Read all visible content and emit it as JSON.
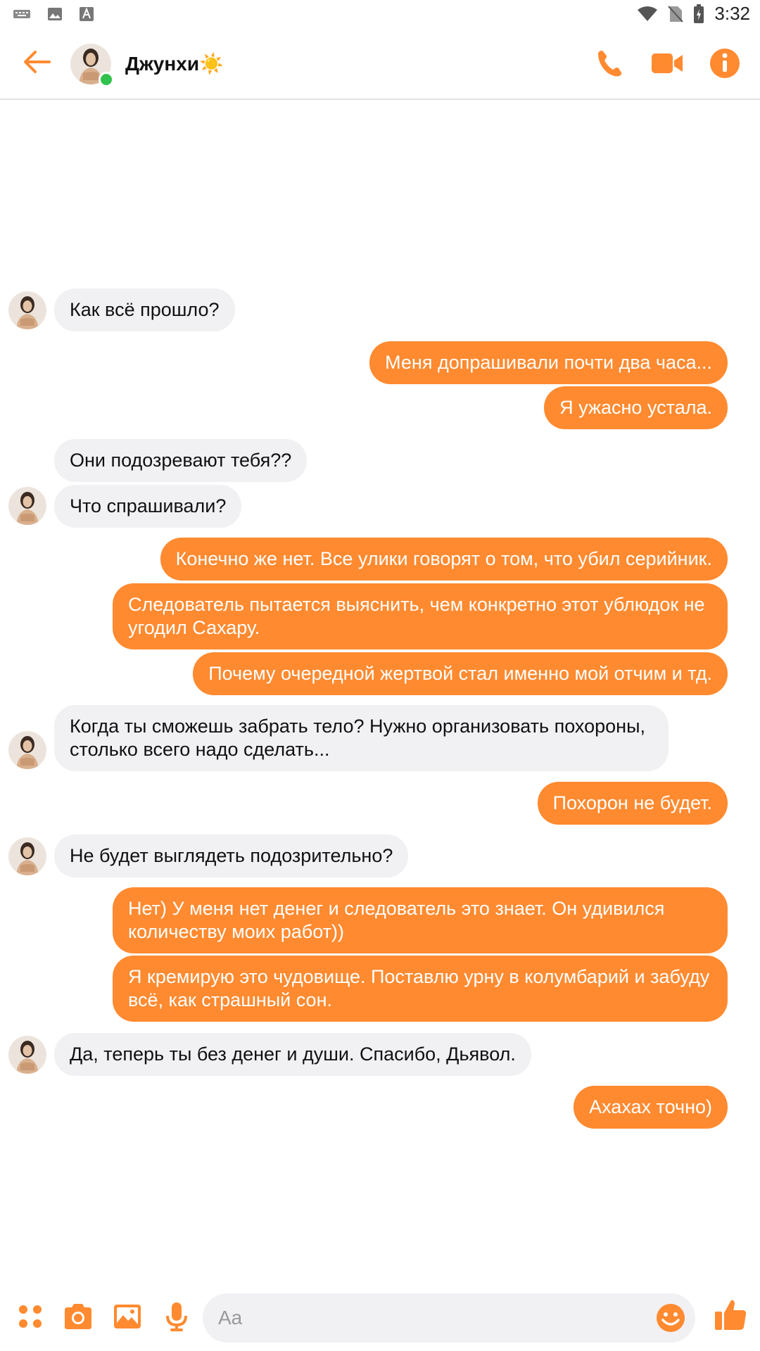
{
  "status_bar": {
    "time": "3:32",
    "left_icons": [
      "keyboard-icon",
      "image-notification-icon",
      "text-a-icon"
    ],
    "right_icons": [
      "wifi-icon",
      "no-sim-icon",
      "battery-charging-icon"
    ]
  },
  "header": {
    "contact_name": "Джунхи☀️",
    "online": true,
    "actions": [
      "phone-icon",
      "video-icon",
      "info-icon"
    ]
  },
  "colors": {
    "accent": "#ff8a30",
    "incoming_bubble": "#f1f0f3",
    "online": "#31c24d"
  },
  "messages": [
    {
      "side": "in",
      "text": "Как всё прошло?"
    },
    {
      "side": "out",
      "text": "Меня допрашивали почти два часа..."
    },
    {
      "side": "out",
      "text": "Я ужасно устала."
    },
    {
      "side": "in",
      "text": "Они подозревают тебя??"
    },
    {
      "side": "in",
      "text": "Что спрашивали?"
    },
    {
      "side": "out",
      "text": "Конечно же нет. Все улики говорят о том, что убил серийник."
    },
    {
      "side": "out",
      "text": "Следователь пытается выяснить, чем конкретно этот ублюдок не угодил Сахару."
    },
    {
      "side": "out",
      "text": "Почему очередной жертвой стал именно мой отчим и тд."
    },
    {
      "side": "in",
      "text": "Когда ты сможешь забрать тело? Нужно организовать похороны, столько всего надо сделать..."
    },
    {
      "side": "out",
      "text": "Похорон не будет."
    },
    {
      "side": "in",
      "text": "Не будет выглядеть подозрительно?"
    },
    {
      "side": "out",
      "text": "Нет) У меня нет денег и следователь это знает. Он удивился количеству моих работ))"
    },
    {
      "side": "out",
      "text": "Я кремирую это чудовище. Поставлю урну в колумбарий и забуду всё, как страшный сон."
    },
    {
      "side": "in",
      "text": "Да, теперь ты без денег и души. Спасибо, Дьявол."
    },
    {
      "side": "out",
      "text": "Ахахах точно)"
    }
  ],
  "composer": {
    "placeholder": "Aa",
    "value": "",
    "icons": [
      "apps-icon",
      "camera-icon",
      "gallery-icon",
      "microphone-icon",
      "emoji-icon",
      "thumbs-up-icon"
    ]
  }
}
